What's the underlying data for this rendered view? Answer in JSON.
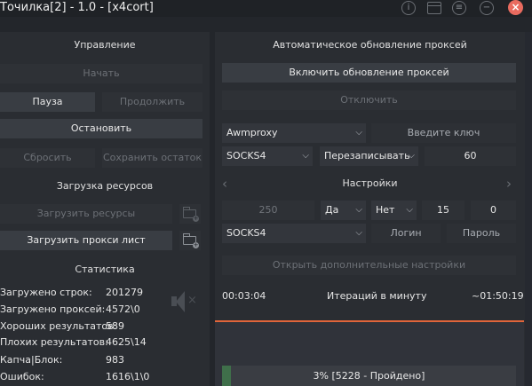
{
  "window": {
    "title": "Точилка[2] - 1.0 - [x4cort]"
  },
  "control": {
    "header": "Управление",
    "start": "Начать",
    "pause": "Пауза",
    "resume": "Продолжить",
    "stop": "Остановить",
    "reset": "Сбросить",
    "save_rest": "Сохранить остаток"
  },
  "resources": {
    "header": "Загрузка ресурсов",
    "load_resources": "Загрузить ресурсы",
    "load_proxy_list": "Загрузить прокси лист"
  },
  "stats": {
    "header": "Статистика",
    "rows": [
      {
        "label": "Загружено строк:",
        "value": "201279"
      },
      {
        "label": "Загружено проксей:",
        "value": "4572\\0"
      },
      {
        "label": "Хороших результатов:",
        "value": "589"
      },
      {
        "label": "Плохих результатов:",
        "value": "4625\\14"
      },
      {
        "label": "Капча|Блок:",
        "value": "983"
      },
      {
        "label": "Ошибок:",
        "value": "1616\\1\\0"
      }
    ]
  },
  "proxy_update": {
    "header": "Автоматическое обновление проксей",
    "enable": "Включить обновление проксей",
    "disable": "Отключить",
    "service": "Awmproxy",
    "key_placeholder": "Введите ключ",
    "proxy_type": "SOCKS4",
    "mode": "Перезаписывать",
    "interval": "60"
  },
  "settings": {
    "header": "Настройки",
    "threads": "250",
    "opt_yes": "Да",
    "opt_no": "Нет",
    "val_15": "15",
    "val_0": "0",
    "proxy_type": "SOCKS4",
    "login": "Логин",
    "password": "Пароль",
    "advanced": "Открыть дополнительные настройки"
  },
  "footer": {
    "elapsed": "00:03:04",
    "rate_label": "Итераций в минуту",
    "remaining": "~01:50:19",
    "progress_text": "3% [5228 - Пройдено]",
    "progress_pct": 3
  },
  "colors": {
    "background": "#23262b",
    "panel": "#2a2d32",
    "button": "#33363c",
    "accent_line": "#e0653a",
    "close": "#e96b5f"
  }
}
